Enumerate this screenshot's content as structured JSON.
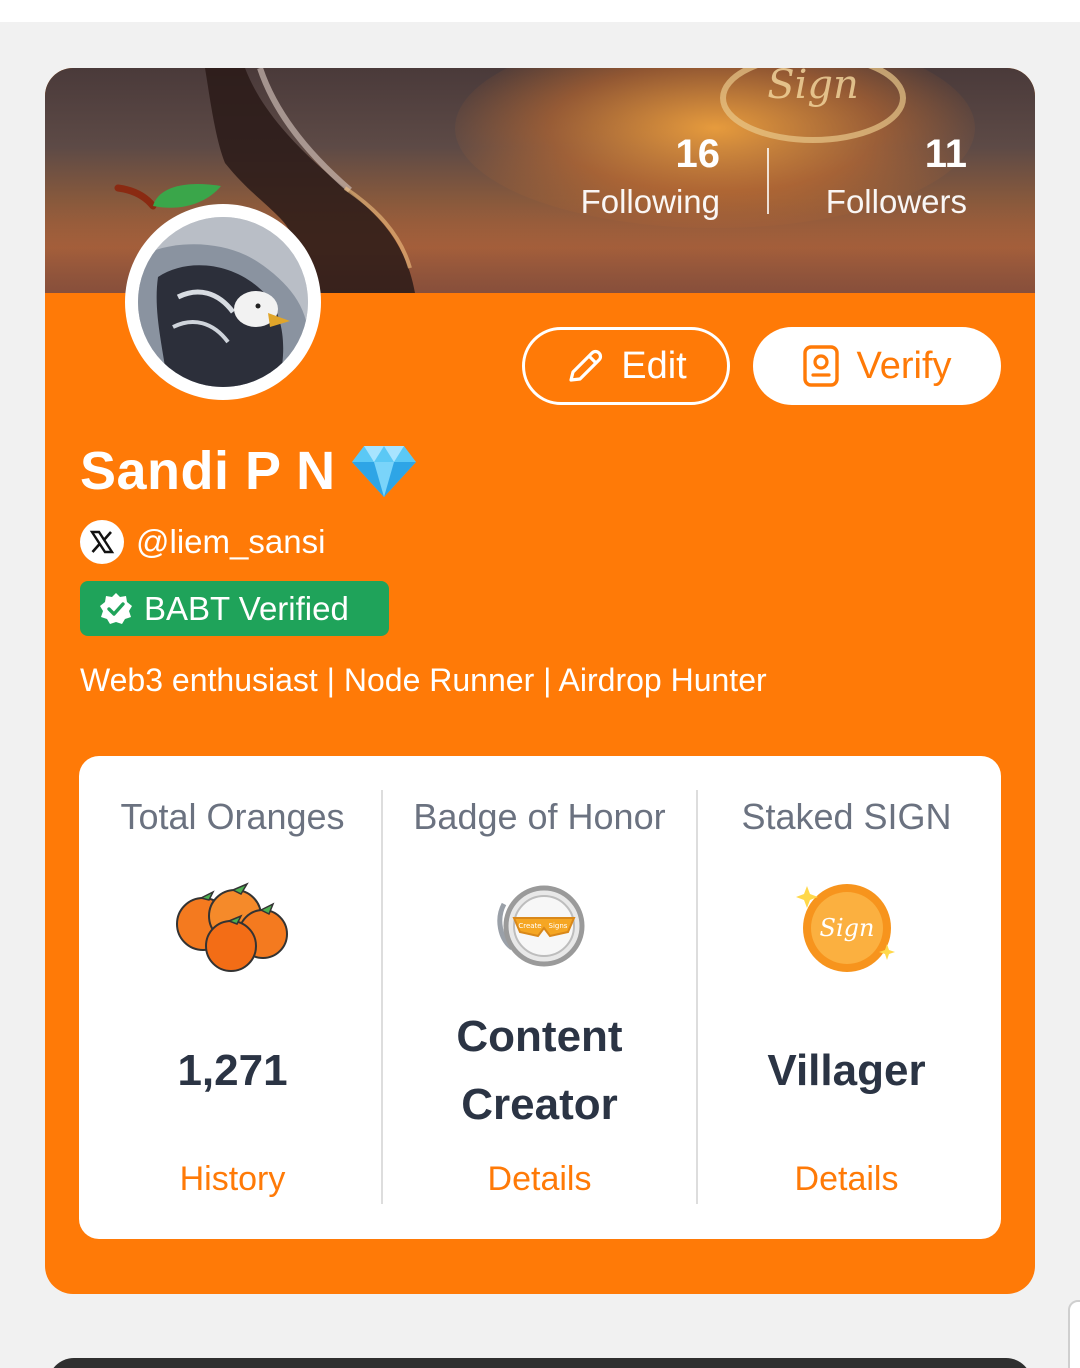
{
  "colors": {
    "accent": "#ff7a07",
    "babt_green": "#1fa35a",
    "text_dark": "#2b3444",
    "text_muted": "#6b7280"
  },
  "profile": {
    "following_count": "16",
    "following_label": "Following",
    "followers_count": "11",
    "followers_label": "Followers",
    "edit_label": "Edit",
    "verify_label": "Verify",
    "name": "Sandi P N",
    "name_badge_icon": "diamond-icon",
    "handle": "@liem_sansi",
    "babt_label": "BABT Verified",
    "bio": "Web3 enthusiast | Node Runner | Airdrop Hunter"
  },
  "summary": [
    {
      "title": "Total Oranges",
      "icon": "oranges-icon",
      "value": "1,271",
      "link": "History"
    },
    {
      "title": "Badge of Honor",
      "icon": "content-creator-badge-icon",
      "value": "Content Creator",
      "link": "Details"
    },
    {
      "title": "Staked SIGN",
      "icon": "sign-coin-icon",
      "value": "Villager",
      "link": "Details"
    }
  ]
}
